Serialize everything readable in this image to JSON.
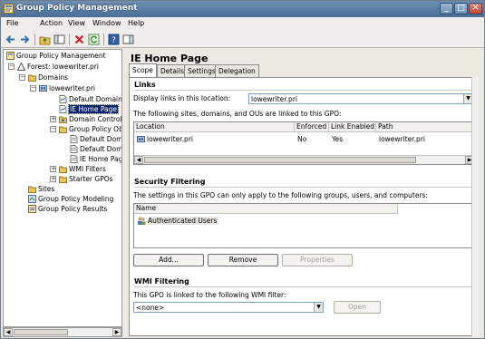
{
  "window": {
    "title": "Group Policy Management"
  },
  "menu": [
    "File",
    "Action",
    "View",
    "Window",
    "Help"
  ],
  "tree": {
    "root": "Group Policy Management",
    "forest": "Forest: lowewriter.pri",
    "domains": "Domains",
    "domain": "lowewriter.pri",
    "items": [
      "Default Domain Po",
      "IE Home Page",
      "Domain Controller",
      "Group Policy Obje"
    ],
    "gpo_children": [
      "Default Domai",
      "Default Domai",
      "IE Home Page"
    ],
    "after": [
      "WMI Filters",
      "Starter GPOs"
    ],
    "bottom": [
      "Sites",
      "Group Policy Modeling",
      "Group Policy Results"
    ]
  },
  "pane": {
    "title": "IE Home Page",
    "tabs": [
      "Scope",
      "Details",
      "Settings",
      "Delegation"
    ],
    "links": {
      "heading": "Links",
      "display_label": "Display links in this location:",
      "location_value": "lowewriter.pri",
      "description": "The following sites, domains, and OUs are linked to this GPO:",
      "columns": [
        "Location",
        "Enforced",
        "Link Enabled",
        "Path"
      ],
      "rows": [
        {
          "location": "lowewriter.pri",
          "enforced": "No",
          "link_enabled": "Yes",
          "path": "lowewriter.pri"
        }
      ]
    },
    "security": {
      "heading": "Security Filtering",
      "description": "The settings in this GPO can only apply to the following groups, users, and computers:",
      "columns": [
        "Name"
      ],
      "rows": [
        "Authenticated Users"
      ],
      "add_label": "Add...",
      "remove_label": "Remove",
      "properties_label": "Properties"
    },
    "wmi": {
      "heading": "WMI Filtering",
      "description": "This GPO is linked to the following WMI filter:",
      "value": "<none>",
      "open_label": "Open"
    }
  },
  "colors": {
    "selection": "#0a246a",
    "titlebar": "#4a6e96"
  }
}
